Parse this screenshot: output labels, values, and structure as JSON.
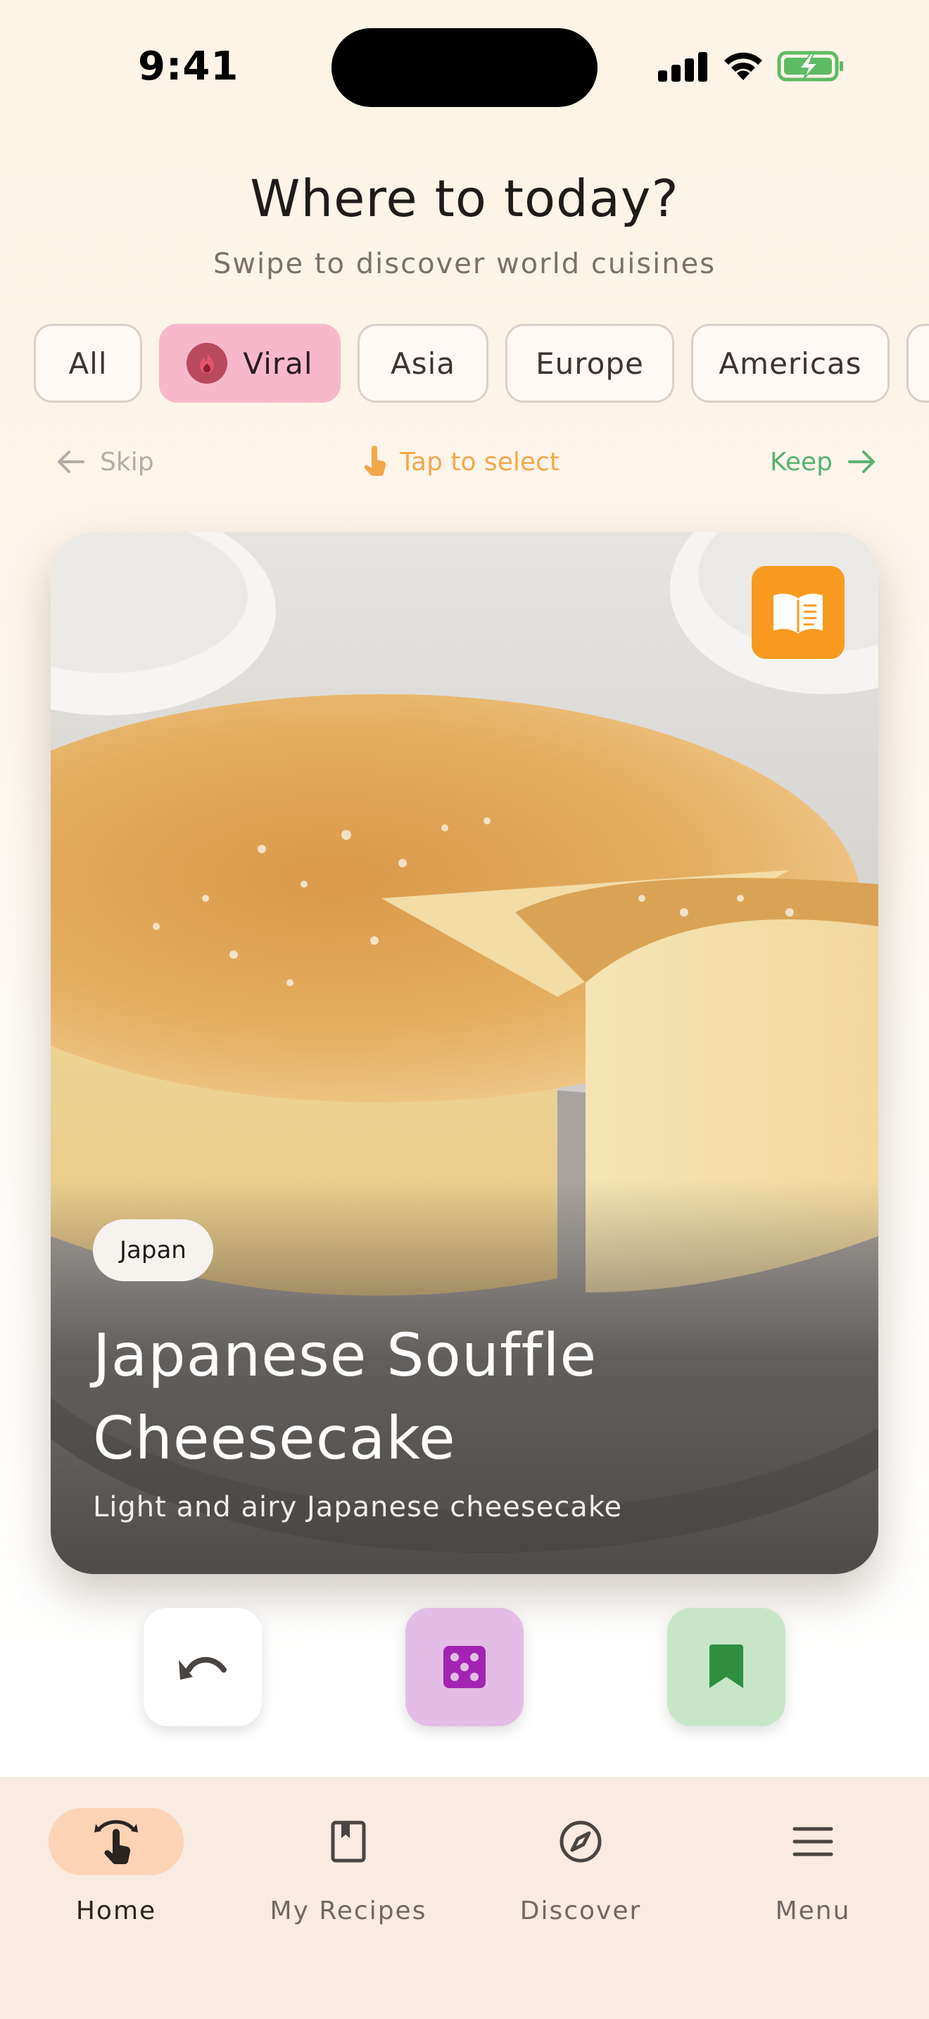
{
  "status_bar": {
    "time": "9:41",
    "icons": [
      "signal-icon",
      "wifi-icon",
      "battery-charging-icon"
    ]
  },
  "header": {
    "title": "Where to today?",
    "subtitle": "Swipe to discover world cuisines"
  },
  "filters": [
    {
      "label": "All",
      "active": false
    },
    {
      "label": "Viral",
      "active": true,
      "icon": "fire-icon"
    },
    {
      "label": "Asia",
      "active": false
    },
    {
      "label": "Europe",
      "active": false
    },
    {
      "label": "Americas",
      "active": false
    }
  ],
  "hints": {
    "skip": "Skip",
    "tap": "Tap to select",
    "keep": "Keep"
  },
  "card": {
    "country": "Japan",
    "title": "Japanese Souffle Cheesecake",
    "description": "Light and airy Japanese cheesecake",
    "recipe_icon": "open-book-icon"
  },
  "actions": [
    {
      "icon": "undo-icon"
    },
    {
      "icon": "dice-icon"
    },
    {
      "icon": "bookmark-icon"
    }
  ],
  "nav": [
    {
      "label": "Home",
      "icon": "swipe-hand-icon",
      "active": true
    },
    {
      "label": "My Recipes",
      "icon": "bookmark-book-icon",
      "active": false
    },
    {
      "label": "Discover",
      "icon": "compass-icon",
      "active": false
    },
    {
      "label": "Menu",
      "icon": "menu-icon",
      "active": false
    }
  ],
  "colors": {
    "accent_orange": "#f89a1f",
    "chip_active": "#f7b8cc",
    "keep_green": "#59b36e",
    "tap_amber": "#f2a84a"
  }
}
